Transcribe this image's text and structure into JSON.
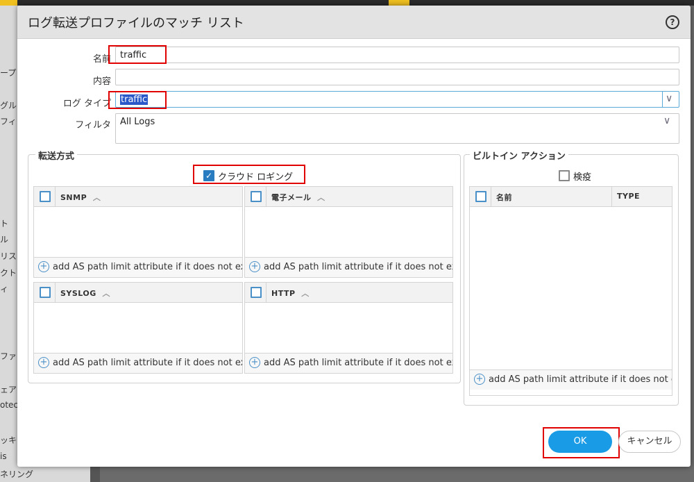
{
  "dialog": {
    "title": "ログ転送プロファイルのマッチ リスト",
    "help_icon": "help-icon"
  },
  "form": {
    "name_label": "名前",
    "name_value": "traffic",
    "description_label": "内容",
    "description_value": "",
    "log_type_label": "ログ タイプ",
    "log_type_value": "traffic",
    "filter_label": "フィルタ",
    "filter_value": "All Logs"
  },
  "forward_method": {
    "legend": "転送方式",
    "cloud_logging_label": "クラウド ロギング",
    "cloud_logging_checked": true,
    "panels": [
      {
        "title": "SNMP",
        "footer": "add AS path limit attribute if it does not exi"
      },
      {
        "title": "電子メール",
        "footer": "add AS path limit attribute if it does not exi"
      },
      {
        "title": "SYSLOG",
        "footer": "add AS path limit attribute if it does not exi"
      },
      {
        "title": "HTTP",
        "footer": "add AS path limit attribute if it does not exi"
      }
    ]
  },
  "builtin_actions": {
    "legend": "ビルトイン アクション",
    "quarantine_label": "検疫",
    "quarantine_checked": false,
    "col_name": "名前",
    "col_type": "TYPE",
    "footer": "add AS path limit attribute if it does not e:"
  },
  "buttons": {
    "ok": "OK",
    "cancel": "キャンセル"
  },
  "background": {
    "fragments": [
      "ープ",
      "グル",
      "フィ",
      "ト",
      "ル",
      "リス",
      "クト",
      "ィ",
      "ファ",
      "ェア",
      "otec",
      "ッキ",
      "is",
      "ネリング"
    ]
  },
  "colors": {
    "accent": "#1a9be6",
    "highlight_box": "#e00000",
    "selection": "#2b58c8"
  }
}
